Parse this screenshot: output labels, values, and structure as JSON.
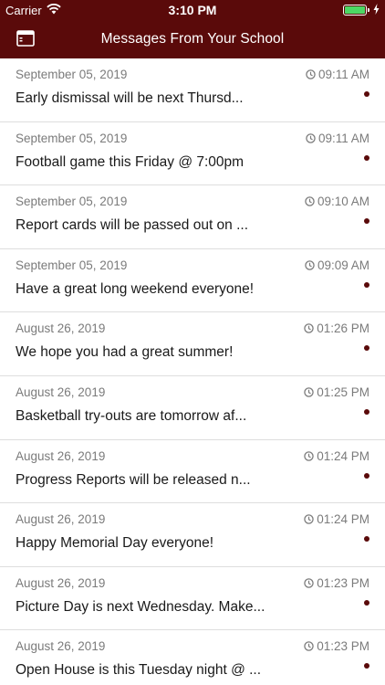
{
  "status": {
    "carrier": "Carrier",
    "time": "3:10 PM",
    "battery_level": 1.0
  },
  "header": {
    "title": "Messages From Your School",
    "menu_icon": "sidebar-icon"
  },
  "colors": {
    "brand": "#5a0a0a",
    "unread_dot": "#5a0a0a"
  },
  "messages": [
    {
      "date": "September 05, 2019",
      "time": "09:11 AM",
      "text": "Early dismissal will be next Thursd...",
      "unread": true
    },
    {
      "date": "September 05, 2019",
      "time": "09:11 AM",
      "text": "Football game this Friday @ 7:00pm",
      "unread": true
    },
    {
      "date": "September 05, 2019",
      "time": "09:10 AM",
      "text": "Report cards will be passed out on ...",
      "unread": true
    },
    {
      "date": "September 05, 2019",
      "time": "09:09 AM",
      "text": "Have a great long weekend everyone!",
      "unread": true
    },
    {
      "date": "August 26, 2019",
      "time": "01:26 PM",
      "text": "We hope you had a great summer!",
      "unread": true
    },
    {
      "date": "August 26, 2019",
      "time": "01:25 PM",
      "text": "Basketball try-outs are tomorrow af...",
      "unread": true
    },
    {
      "date": "August 26, 2019",
      "time": "01:24 PM",
      "text": "Progress Reports will be released n...",
      "unread": true
    },
    {
      "date": "August 26, 2019",
      "time": "01:24 PM",
      "text": "Happy Memorial Day everyone!",
      "unread": true
    },
    {
      "date": "August 26, 2019",
      "time": "01:23 PM",
      "text": "Picture Day is next Wednesday. Make...",
      "unread": true
    },
    {
      "date": "August 26, 2019",
      "time": "01:23 PM",
      "text": "Open House is this Tuesday night @ ...",
      "unread": true
    }
  ]
}
